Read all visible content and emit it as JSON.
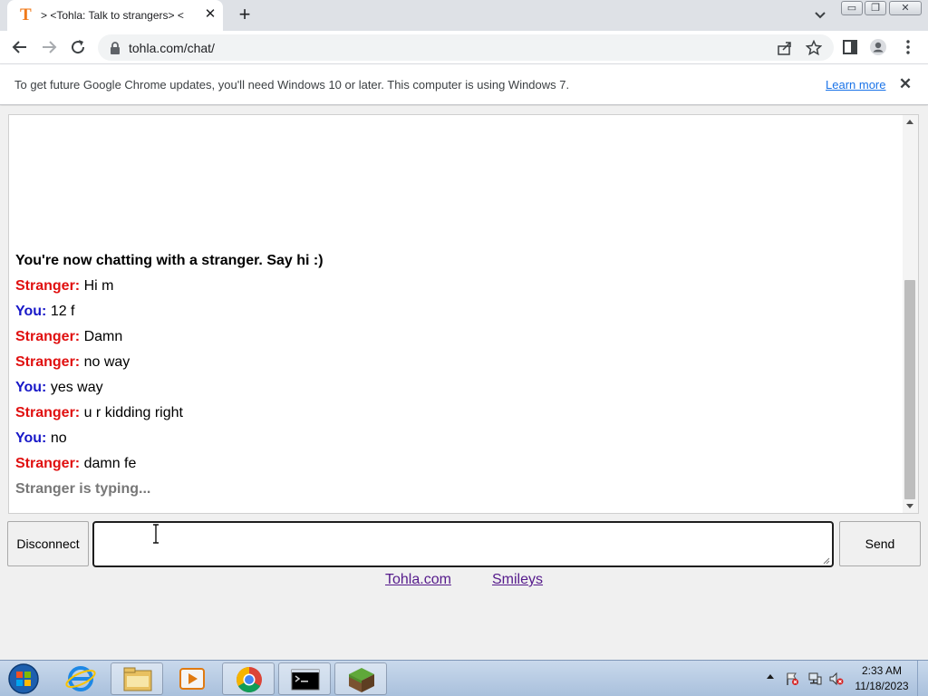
{
  "browser": {
    "tab": {
      "favicon_letter": "T",
      "title": "> <Tohla: Talk to strangers> <",
      "close_symbol": "✕"
    },
    "new_tab_symbol": "+",
    "window_controls": {
      "minimize": "▭",
      "restore": "❐",
      "close": "✕"
    },
    "url": "tohla.com/chat/",
    "infobar": {
      "message": "To get future Google Chrome updates, you'll need Windows 10 or later. This computer is using Windows 7.",
      "link": "Learn more",
      "close_symbol": "✕"
    }
  },
  "chat": {
    "status": "You're now chatting with a stranger. Say hi :)",
    "messages": [
      {
        "sender": "stranger",
        "label": "Stranger:",
        "text": "Hi m"
      },
      {
        "sender": "you",
        "label": "You:",
        "text": "12 f"
      },
      {
        "sender": "stranger",
        "label": "Stranger:",
        "text": "Damn"
      },
      {
        "sender": "stranger",
        "label": "Stranger:",
        "text": "no way"
      },
      {
        "sender": "you",
        "label": "You:",
        "text": "yes way"
      },
      {
        "sender": "stranger",
        "label": "Stranger:",
        "text": "u r kidding right"
      },
      {
        "sender": "you",
        "label": "You:",
        "text": "no"
      },
      {
        "sender": "stranger",
        "label": "Stranger:",
        "text": "damn fe"
      }
    ],
    "typing": "Stranger is typing...",
    "input_value": "",
    "disconnect_label": "Disconnect",
    "send_label": "Send",
    "footer_links": [
      "Tohla.com",
      "Smileys"
    ]
  },
  "taskbar": {
    "apps": [
      "internet-explorer",
      "windows-explorer",
      "media-player",
      "chrome",
      "command-prompt",
      "minecraft"
    ],
    "active_app": "chrome",
    "clock_time": "2:33 AM",
    "clock_date": "11/18/2023"
  },
  "colors": {
    "stranger": "#e01010",
    "you": "#1818c8",
    "typing": "#777777",
    "link": "#551a8b"
  }
}
